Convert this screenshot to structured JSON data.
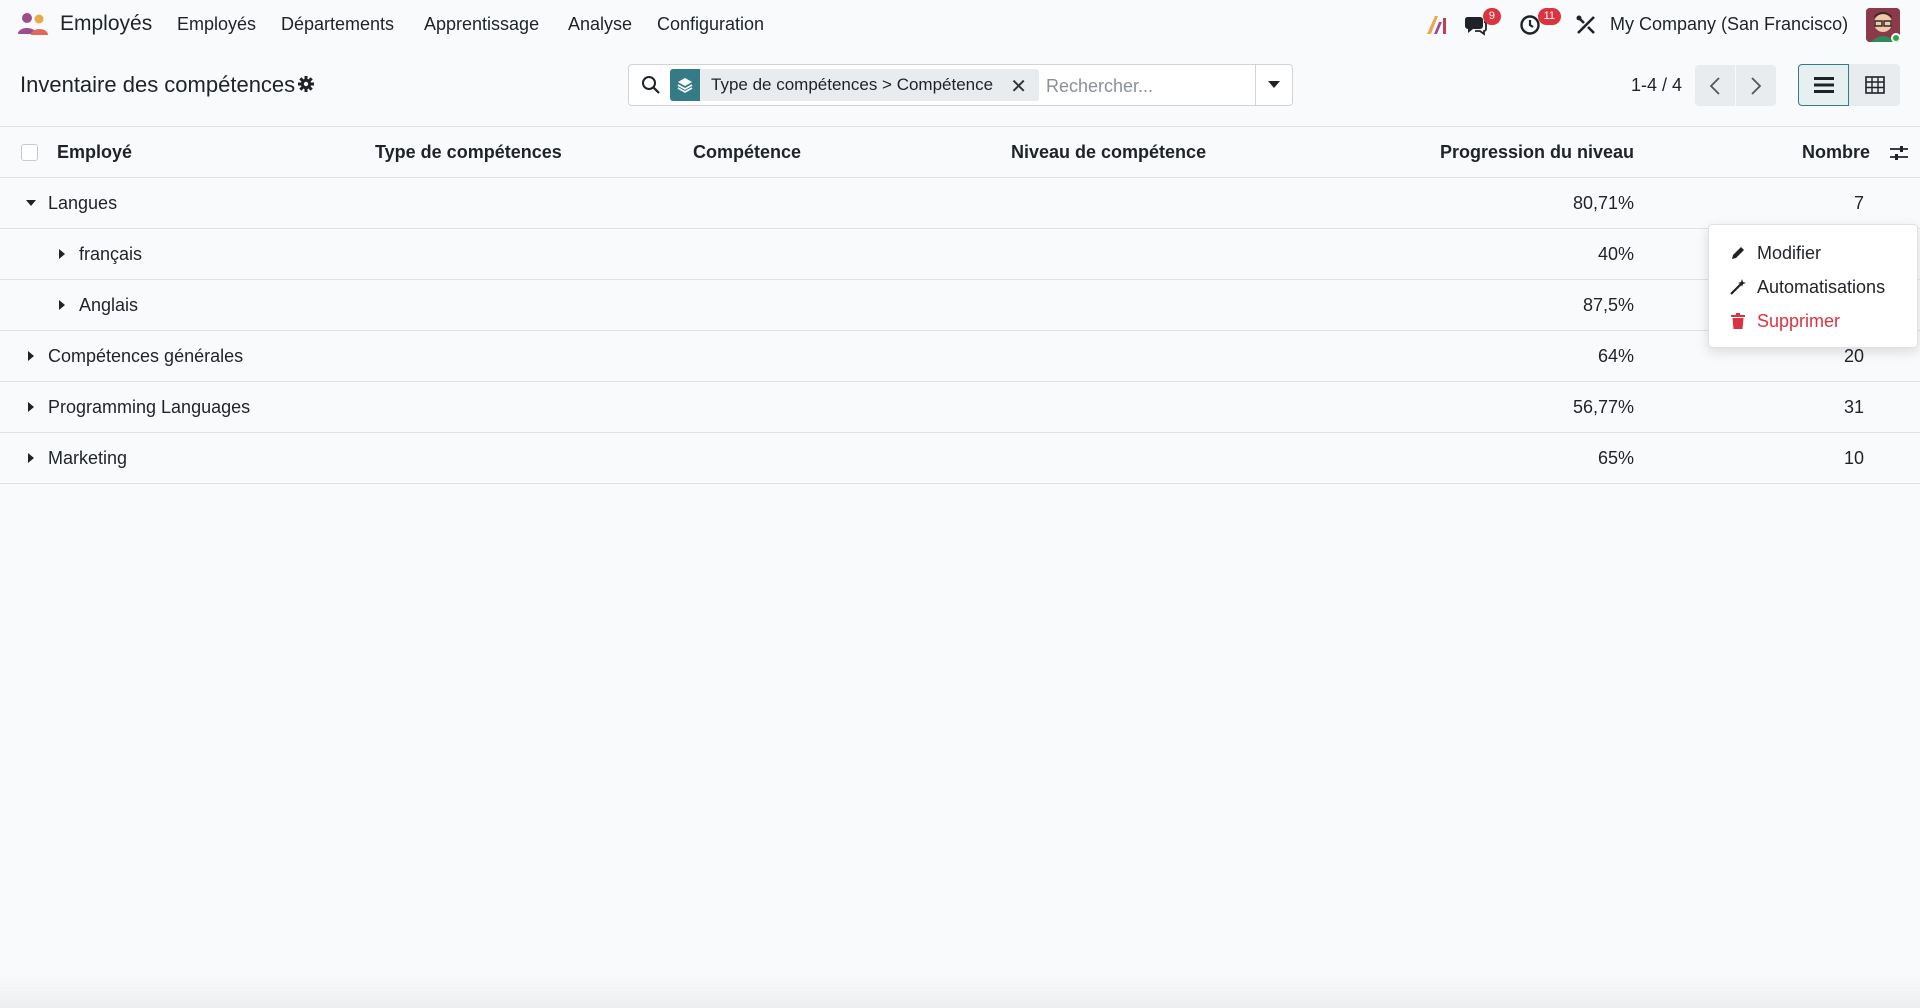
{
  "navbar": {
    "app_name": "Employés",
    "menu": [
      "Employés",
      "Départements",
      "Apprentissage",
      "Analyse",
      "Configuration"
    ],
    "messages_badge": "9",
    "activities_badge": "11",
    "company": "My Company (San Francisco)"
  },
  "control": {
    "title": "Inventaire des compétences",
    "facet": "Type de compétences > Compétence",
    "search_placeholder": "Rechercher...",
    "pager": "1-4 / 4"
  },
  "columns": [
    "Employé",
    "Type de compétences",
    "Compétence",
    "Niveau de compétence",
    "Progression du niveau",
    "Nombre"
  ],
  "rows": [
    {
      "label": "Langues",
      "level": 0,
      "expanded": true,
      "progress": "80,71%",
      "count": "7"
    },
    {
      "label": "français",
      "level": 1,
      "expanded": false,
      "progress": "40%",
      "count": ""
    },
    {
      "label": "Anglais",
      "level": 1,
      "expanded": false,
      "progress": "87,5%",
      "count": ""
    },
    {
      "label": "Compétences générales",
      "level": 0,
      "expanded": false,
      "progress": "64%",
      "count": "20"
    },
    {
      "label": "Programming Languages",
      "level": 0,
      "expanded": false,
      "progress": "56,77%",
      "count": "31"
    },
    {
      "label": "Marketing",
      "level": 0,
      "expanded": false,
      "progress": "65%",
      "count": "10"
    }
  ],
  "dropdown": {
    "modify": "Modifier",
    "automations": "Automatisations",
    "delete": "Supprimer"
  },
  "colors": {
    "accent": "#357b86",
    "danger": "#d9343f",
    "badge": "#d9343f"
  }
}
